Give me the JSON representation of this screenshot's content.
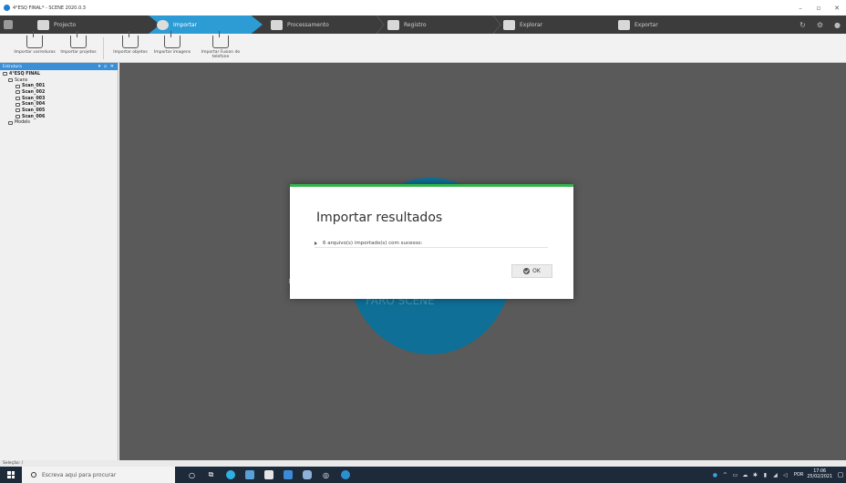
{
  "window": {
    "title": "4°ESQ FINAL* - SCENE 2020.0.3"
  },
  "tabs": [
    {
      "label": "Projecto"
    },
    {
      "label": "Importar"
    },
    {
      "label": "Processamento"
    },
    {
      "label": "Registro"
    },
    {
      "label": "Explorar"
    },
    {
      "label": "Exportar"
    }
  ],
  "ribbon": {
    "buttons": [
      {
        "label": "Importar varreduras"
      },
      {
        "label": "Importar projetos"
      },
      {
        "label": "Importar objetos"
      },
      {
        "label": "Importar imagens"
      },
      {
        "label": "Importar Fusion do telefone"
      }
    ]
  },
  "panel": {
    "header": "Estrutura",
    "controls": "▾ ▫ ✕",
    "tree": [
      {
        "label": "4°ESQ FINAL",
        "bold": true
      },
      {
        "label": "Scans"
      },
      {
        "label": "Scan_001",
        "bold": true
      },
      {
        "label": "Scan_002",
        "bold": true
      },
      {
        "label": "Scan_003",
        "bold": true
      },
      {
        "label": "Scan_004",
        "bold": true
      },
      {
        "label": "Scan_005",
        "bold": true
      },
      {
        "label": "Scan_006",
        "bold": true
      },
      {
        "label": "Models"
      }
    ]
  },
  "dialog": {
    "title": "Importar resultados",
    "row": "6 arquivo(s) importado(s) com sucesso:",
    "ok_label": "OK",
    "accent_color": "#33b34a"
  },
  "workspace": {
    "background_label": "FARO SCENE"
  },
  "status": {
    "text": "Seleção: /"
  },
  "taskbar": {
    "search_placeholder": "Escreva aqui para procurar",
    "language": "POR",
    "time": "17:06",
    "date": "25/02/2021"
  },
  "colors": {
    "active_tab": "#2d9bd4",
    "workspace": "#5a5a5a",
    "globe": "#0f6f96",
    "taskbar": "#1c2a3a"
  }
}
